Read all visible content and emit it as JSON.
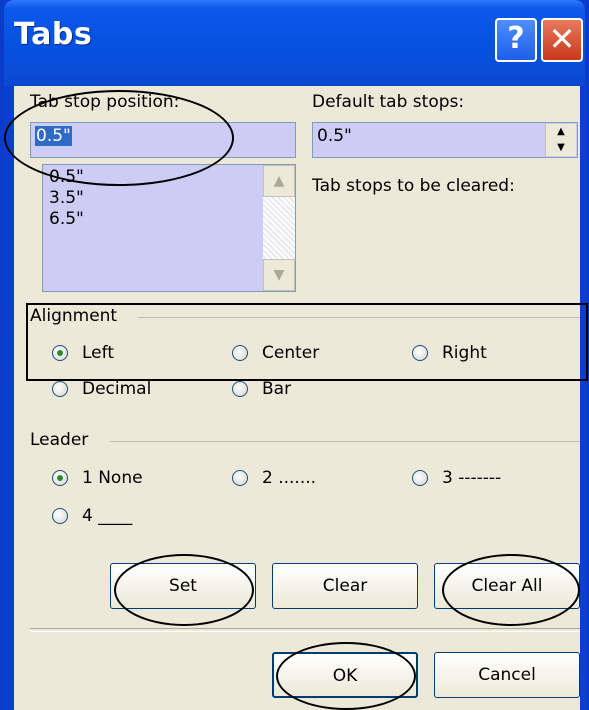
{
  "window": {
    "title": "Tabs",
    "help_glyph": "?",
    "close_glyph": "✕"
  },
  "tab_stop_position": {
    "label": "Tab stop position:",
    "value": "0.5\"",
    "list": [
      "0.5\"",
      "3.5\"",
      "6.5\""
    ]
  },
  "default_tab_stops": {
    "label": "Default tab stops:",
    "value": "0.5\""
  },
  "tab_stops_cleared_label": "Tab stops to be cleared:",
  "alignment": {
    "label": "Alignment",
    "options": [
      {
        "label": "Left",
        "selected": true
      },
      {
        "label": "Center",
        "selected": false
      },
      {
        "label": "Right",
        "selected": false
      },
      {
        "label": "Decimal",
        "selected": false
      },
      {
        "label": "Bar",
        "selected": false
      }
    ]
  },
  "leader": {
    "label": "Leader",
    "options": [
      {
        "label": "1 None",
        "selected": true
      },
      {
        "label": "2 .......",
        "selected": false
      },
      {
        "label": "3 -------",
        "selected": false
      },
      {
        "label": "4 ____",
        "selected": false
      }
    ]
  },
  "buttons": {
    "set": "Set",
    "clear": "Clear",
    "clear_all": "Clear All",
    "ok": "OK",
    "cancel": "Cancel"
  },
  "icons": {
    "scroll_up": "up-arrow-icon",
    "scroll_down": "down-arrow-icon",
    "spin_up": "spin-up-icon",
    "spin_down": "spin-down-icon"
  }
}
